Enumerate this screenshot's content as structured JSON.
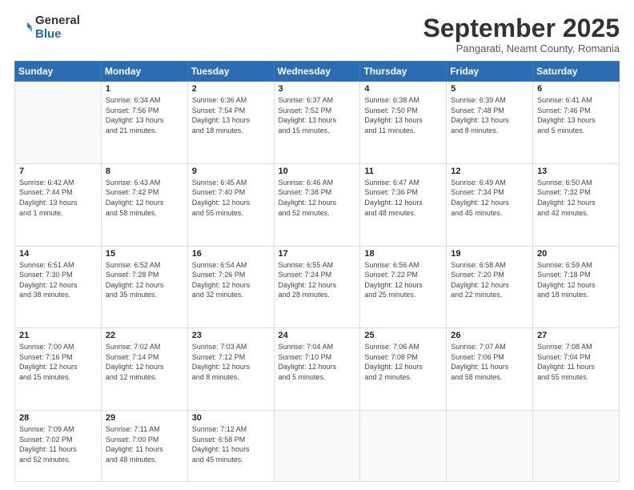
{
  "logo": {
    "general": "General",
    "blue": "Blue"
  },
  "header": {
    "month": "September 2025",
    "location": "Pangarati, Neamt County, Romania"
  },
  "weekdays": [
    "Sunday",
    "Monday",
    "Tuesday",
    "Wednesday",
    "Thursday",
    "Friday",
    "Saturday"
  ],
  "weeks": [
    [
      {
        "day": "",
        "info": ""
      },
      {
        "day": "1",
        "info": "Sunrise: 6:34 AM\nSunset: 7:56 PM\nDaylight: 13 hours\nand 21 minutes."
      },
      {
        "day": "2",
        "info": "Sunrise: 6:36 AM\nSunset: 7:54 PM\nDaylight: 13 hours\nand 18 minutes."
      },
      {
        "day": "3",
        "info": "Sunrise: 6:37 AM\nSunset: 7:52 PM\nDaylight: 13 hours\nand 15 minutes."
      },
      {
        "day": "4",
        "info": "Sunrise: 6:38 AM\nSunset: 7:50 PM\nDaylight: 13 hours\nand 11 minutes."
      },
      {
        "day": "5",
        "info": "Sunrise: 6:39 AM\nSunset: 7:48 PM\nDaylight: 13 hours\nand 8 minutes."
      },
      {
        "day": "6",
        "info": "Sunrise: 6:41 AM\nSunset: 7:46 PM\nDaylight: 13 hours\nand 5 minutes."
      }
    ],
    [
      {
        "day": "7",
        "info": "Sunrise: 6:42 AM\nSunset: 7:44 PM\nDaylight: 13 hours\nand 1 minute."
      },
      {
        "day": "8",
        "info": "Sunrise: 6:43 AM\nSunset: 7:42 PM\nDaylight: 12 hours\nand 58 minutes."
      },
      {
        "day": "9",
        "info": "Sunrise: 6:45 AM\nSunset: 7:40 PM\nDaylight: 12 hours\nand 55 minutes."
      },
      {
        "day": "10",
        "info": "Sunrise: 6:46 AM\nSunset: 7:38 PM\nDaylight: 12 hours\nand 52 minutes."
      },
      {
        "day": "11",
        "info": "Sunrise: 6:47 AM\nSunset: 7:36 PM\nDaylight: 12 hours\nand 48 minutes."
      },
      {
        "day": "12",
        "info": "Sunrise: 6:49 AM\nSunset: 7:34 PM\nDaylight: 12 hours\nand 45 minutes."
      },
      {
        "day": "13",
        "info": "Sunrise: 6:50 AM\nSunset: 7:32 PM\nDaylight: 12 hours\nand 42 minutes."
      }
    ],
    [
      {
        "day": "14",
        "info": "Sunrise: 6:51 AM\nSunset: 7:30 PM\nDaylight: 12 hours\nand 38 minutes."
      },
      {
        "day": "15",
        "info": "Sunrise: 6:52 AM\nSunset: 7:28 PM\nDaylight: 12 hours\nand 35 minutes."
      },
      {
        "day": "16",
        "info": "Sunrise: 6:54 AM\nSunset: 7:26 PM\nDaylight: 12 hours\nand 32 minutes."
      },
      {
        "day": "17",
        "info": "Sunrise: 6:55 AM\nSunset: 7:24 PM\nDaylight: 12 hours\nand 28 minutes."
      },
      {
        "day": "18",
        "info": "Sunrise: 6:56 AM\nSunset: 7:22 PM\nDaylight: 12 hours\nand 25 minutes."
      },
      {
        "day": "19",
        "info": "Sunrise: 6:58 AM\nSunset: 7:20 PM\nDaylight: 12 hours\nand 22 minutes."
      },
      {
        "day": "20",
        "info": "Sunrise: 6:59 AM\nSunset: 7:18 PM\nDaylight: 12 hours\nand 18 minutes."
      }
    ],
    [
      {
        "day": "21",
        "info": "Sunrise: 7:00 AM\nSunset: 7:16 PM\nDaylight: 12 hours\nand 15 minutes."
      },
      {
        "day": "22",
        "info": "Sunrise: 7:02 AM\nSunset: 7:14 PM\nDaylight: 12 hours\nand 12 minutes."
      },
      {
        "day": "23",
        "info": "Sunrise: 7:03 AM\nSunset: 7:12 PM\nDaylight: 12 hours\nand 8 minutes."
      },
      {
        "day": "24",
        "info": "Sunrise: 7:04 AM\nSunset: 7:10 PM\nDaylight: 12 hours\nand 5 minutes."
      },
      {
        "day": "25",
        "info": "Sunrise: 7:06 AM\nSunset: 7:08 PM\nDaylight: 12 hours\nand 2 minutes."
      },
      {
        "day": "26",
        "info": "Sunrise: 7:07 AM\nSunset: 7:06 PM\nDaylight: 11 hours\nand 58 minutes."
      },
      {
        "day": "27",
        "info": "Sunrise: 7:08 AM\nSunset: 7:04 PM\nDaylight: 11 hours\nand 55 minutes."
      }
    ],
    [
      {
        "day": "28",
        "info": "Sunrise: 7:09 AM\nSunset: 7:02 PM\nDaylight: 11 hours\nand 52 minutes."
      },
      {
        "day": "29",
        "info": "Sunrise: 7:11 AM\nSunset: 7:00 PM\nDaylight: 11 hours\nand 48 minutes."
      },
      {
        "day": "30",
        "info": "Sunrise: 7:12 AM\nSunset: 6:58 PM\nDaylight: 11 hours\nand 45 minutes."
      },
      {
        "day": "",
        "info": ""
      },
      {
        "day": "",
        "info": ""
      },
      {
        "day": "",
        "info": ""
      },
      {
        "day": "",
        "info": ""
      }
    ]
  ]
}
